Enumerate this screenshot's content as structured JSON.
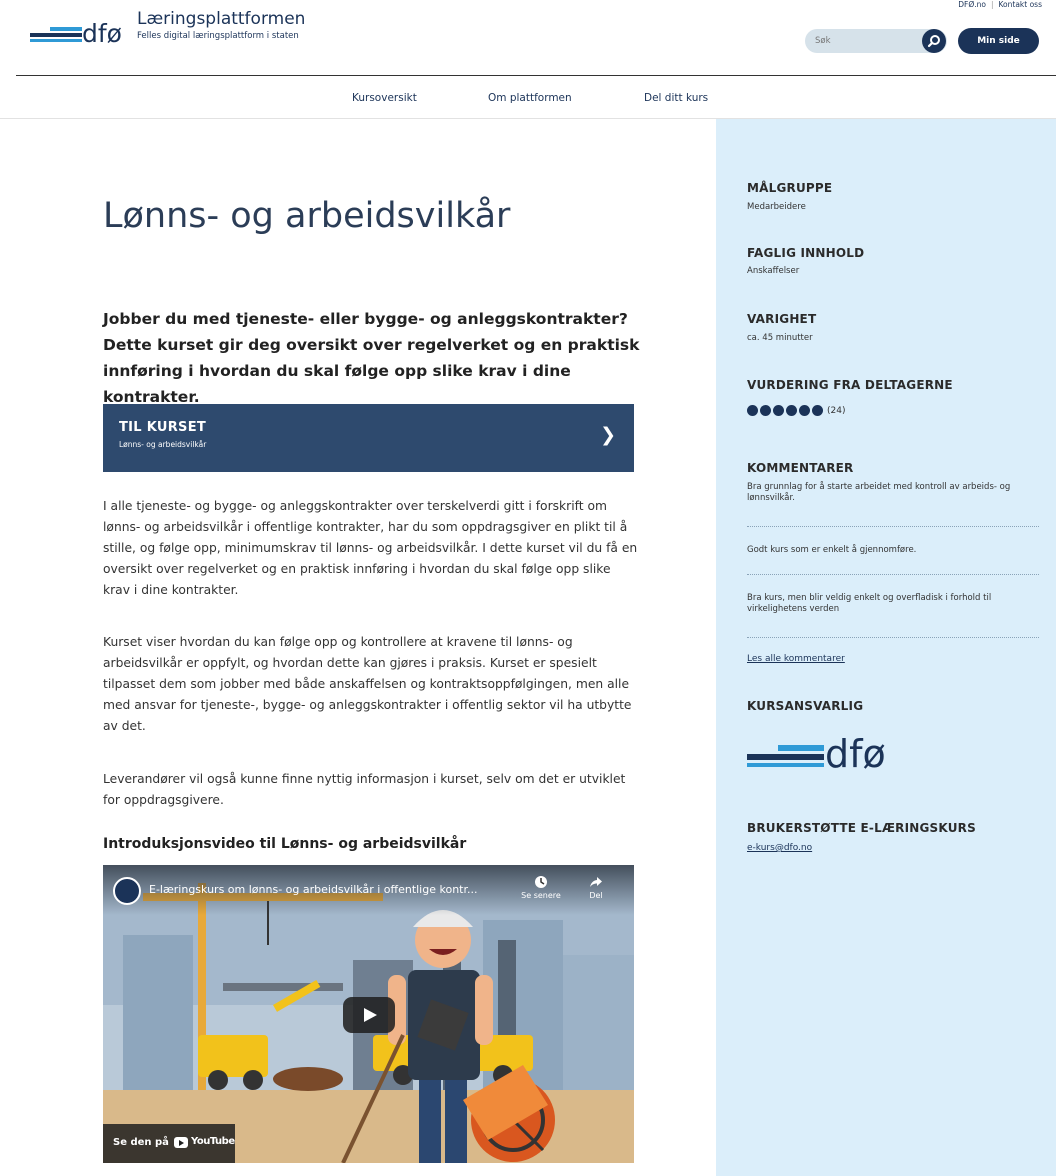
{
  "header": {
    "logo_text": "dfø",
    "site_title": "Læringsplattformen",
    "site_subtitle": "Felles digital læringsplattform i staten",
    "top_links": [
      "DFØ.no",
      "Kontakt oss"
    ],
    "search_placeholder": "Søk",
    "my_page": "Min side"
  },
  "nav": {
    "items": [
      "Kursoversikt",
      "Om plattformen",
      "Del ditt kurs"
    ]
  },
  "main": {
    "title": "Lønns- og arbeidsvilkår",
    "lead": "Jobber du med tjeneste- eller bygge- og anleggskontrakter? Dette kurset gir deg oversikt over regelverket og en praktisk innføring i hvordan du skal følge opp slike krav i dine kontrakter.",
    "cta": {
      "title": "TIL KURSET",
      "subtitle": "Lønns- og arbeidsvilkår"
    },
    "paragraphs": [
      "I alle tjeneste- og bygge- og anleggskontrakter over terskelverdi gitt i forskrift om lønns- og arbeidsvilkår i offentlige kontrakter, har du som oppdragsgiver en plikt til å stille, og følge opp, minimumskrav til lønns- og arbeidsvilkår. I dette kurset vil du få en oversikt over regelverket og en praktisk innføring i hvordan du skal følge opp slike krav i dine kontrakter.",
      "Kurset viser hvordan du kan følge opp og kontrollere at kravene til lønns- og arbeidsvilkår er oppfylt, og hvordan dette kan gjøres i praksis. Kurset er spesielt tilpasset dem som jobber med både anskaffelsen og kontraktsoppfølgingen, men alle med ansvar for tjeneste-, bygge- og anleggskontrakter i offentlig sektor vil ha utbytte av det.",
      "Leverandører vil også kunne finne nyttig informasjon i kurset, selv om det er utviklet for oppdragsgivere."
    ],
    "video_heading": "Introduksjonsvideo til Lønns- og arbeidsvilkår",
    "video": {
      "title": "E-læringskurs om lønns- og arbeidsvilkår i offentlige kontr...",
      "watch_later": "Se senere",
      "share": "Del",
      "watch_on": "Se den på",
      "youtube": "YouTube"
    }
  },
  "sidebar": {
    "target_group_label": "MÅLGRUPPE",
    "target_group": "Medarbeidere",
    "content_label": "FAGLIG INNHOLD",
    "content": "Anskaffelser",
    "duration_label": "VARIGHET",
    "duration": "ca. 45 minutter",
    "rating_label": "VURDERING FRA DELTAGERNE",
    "rating_dots": 6,
    "rating_count": "(24)",
    "comments_label": "KOMMENTARER",
    "comments": [
      "Bra grunnlag for å starte arbeidet med kontroll av arbeids- og lønnsvilkår.",
      "Godt kurs som er enkelt å gjennomføre.",
      "Bra kurs, men blir veldig enkelt og overfladisk i forhold til virkelighetens verden"
    ],
    "read_all": "Les alle kommentarer",
    "responsible_label": "KURSANSVARLIG",
    "responsible_logo_text": "dfø",
    "support_label": "BRUKERSTØTTE E-LÆRINGSKURS",
    "support_email": "e-kurs@dfo.no"
  },
  "colors": {
    "brand_navy": "#1b3358",
    "brand_blue": "#2f9ad6",
    "cta_bg": "#2e4a6e",
    "sidebar_bg": "#dbeefa"
  }
}
